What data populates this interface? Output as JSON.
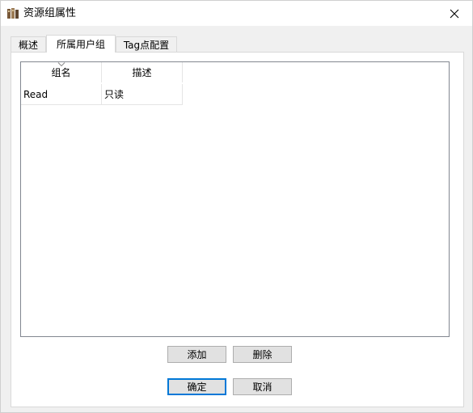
{
  "window": {
    "title": "资源组属性",
    "icons": {
      "app": "resource-group-app-icon",
      "close": "close-icon"
    }
  },
  "tabs": [
    {
      "label": "概述",
      "active": false
    },
    {
      "label": "所属用户组",
      "active": true
    },
    {
      "label": "Tag点配置",
      "active": false
    }
  ],
  "list": {
    "columns": [
      "组名",
      "描述"
    ],
    "rows": [
      [
        "Read",
        "只读"
      ]
    ],
    "sort_icon": "sort-indicator-icon"
  },
  "buttons": {
    "add": "添加",
    "delete": "删除",
    "ok": "确定",
    "cancel": "取消"
  }
}
